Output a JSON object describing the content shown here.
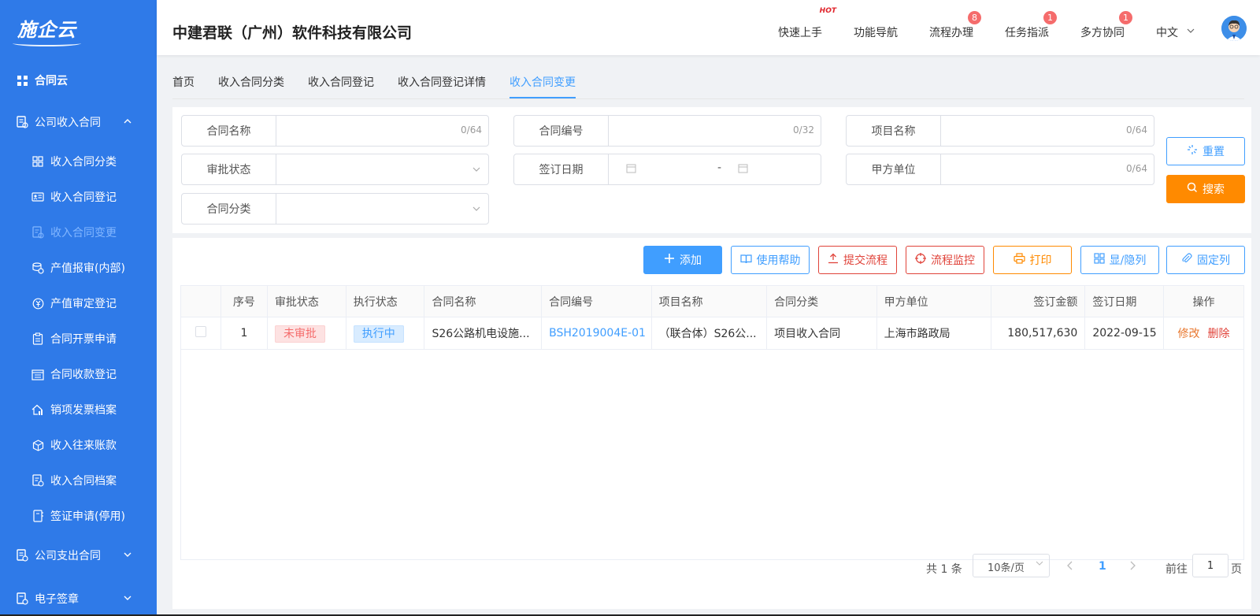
{
  "sidebar": {
    "logo": "施企云",
    "items": [
      {
        "label": "合同云",
        "icon": "grid-icon"
      },
      {
        "label": "公司收入合同",
        "icon": "contract-icon"
      },
      {
        "label": "收入合同分类",
        "icon": "apps-icon"
      },
      {
        "label": "收入合同登记",
        "icon": "id-card-icon"
      },
      {
        "label": "收入合同变更",
        "icon": "document-edit-icon"
      },
      {
        "label": "产值报审(内部)",
        "icon": "coins-icon"
      },
      {
        "label": "产值审定登记",
        "icon": "yen-circle-icon"
      },
      {
        "label": "合同开票申请",
        "icon": "clipboard-icon"
      },
      {
        "label": "合同收款登记",
        "icon": "calendar-list-icon"
      },
      {
        "label": "销项发票档案",
        "icon": "house-chart-icon"
      },
      {
        "label": "收入往来账款",
        "icon": "cube-icon"
      },
      {
        "label": "收入合同档案",
        "icon": "archive-icon"
      },
      {
        "label": "签证申请(停用)",
        "icon": "notebook-icon"
      },
      {
        "label": "公司支出合同",
        "icon": "contract-icon"
      },
      {
        "label": "电子签章",
        "icon": "stamp-icon"
      }
    ]
  },
  "header": {
    "company": "中建君联（广州）软件科技有限公司",
    "nav": [
      {
        "label": "快速上手",
        "badge": "HOT"
      },
      {
        "label": "功能导航",
        "badge": ""
      },
      {
        "label": "流程办理",
        "badge": "8"
      },
      {
        "label": "任务指派",
        "badge": "1"
      },
      {
        "label": "多方协同",
        "badge": "1"
      }
    ],
    "language": "中文"
  },
  "tabs": [
    "首页",
    "收入合同分类",
    "收入合同登记",
    "收入合同登记详情",
    "收入合同变更"
  ],
  "filter": {
    "contract_name": {
      "label": "合同名称",
      "count": "0/64"
    },
    "contract_no": {
      "label": "合同编号",
      "count": "0/32"
    },
    "project_name": {
      "label": "项目名称",
      "count": "0/64"
    },
    "approval_status": {
      "label": "审批状态"
    },
    "sign_date": {
      "label": "签订日期",
      "separator": "-"
    },
    "party_a": {
      "label": "甲方单位",
      "count": "0/64"
    },
    "contract_category": {
      "label": "合同分类"
    },
    "reset": "重置",
    "search": "搜索"
  },
  "toolbar": {
    "add": "添加",
    "help": "使用帮助",
    "submit_flow": "提交流程",
    "monitor_flow": "流程监控",
    "print": "打印",
    "toggle_columns": "显/隐列",
    "pin_columns": "固定列"
  },
  "table": {
    "headers": [
      "序号",
      "审批状态",
      "执行状态",
      "合同名称",
      "合同编号",
      "项目名称",
      "合同分类",
      "甲方单位",
      "签订金额",
      "签订日期",
      "操作"
    ],
    "rows": [
      {
        "index": "1",
        "approval": "未审批",
        "execution": "执行中",
        "name": "S26公路机电设施...",
        "code": "BSH2019004E-01",
        "project": "（联合体）S26公...",
        "category": "项目收入合同",
        "party_a": "上海市路政局",
        "amount": "180,517,630",
        "date": "2022-09-15",
        "edit": "修改",
        "delete": "删除"
      }
    ]
  },
  "pagination": {
    "total": "共 1 条",
    "page_size": "10条/页",
    "current_page": "1",
    "goto_label": "前往",
    "goto_value": "1",
    "page_unit": "页"
  },
  "colors": {
    "sidebar": "#2f7ae8",
    "primary": "#409eff",
    "orange": "#ff8a00",
    "danger": "#e0433a"
  }
}
